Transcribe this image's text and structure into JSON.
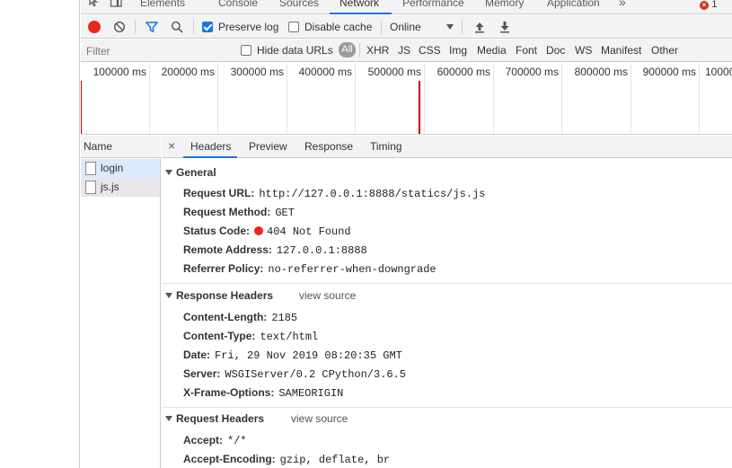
{
  "top_tabs": [
    "Elements",
    "Console",
    "Sources",
    "Network",
    "Performance",
    "Memory",
    "Application"
  ],
  "top_tabs_overflow": "»",
  "error_count": "1",
  "toolbar": {
    "preserve_log_label": "Preserve log",
    "preserve_log_checked": true,
    "disable_cache_label": "Disable cache",
    "disable_cache_checked": false,
    "throttle_value": "Online"
  },
  "filterbar": {
    "filter_placeholder": "Filter",
    "hide_data_urls_label": "Hide data URLs",
    "types": [
      "All",
      "XHR",
      "JS",
      "CSS",
      "Img",
      "Media",
      "Font",
      "Doc",
      "WS",
      "Manifest",
      "Other"
    ]
  },
  "overview": {
    "ticks": [
      "100000 ms",
      "200000 ms",
      "300000 ms",
      "400000 ms",
      "500000 ms",
      "600000 ms",
      "700000 ms",
      "800000 ms",
      "900000 ms",
      "10000"
    ]
  },
  "requests": {
    "column_name": "Name",
    "items": [
      "login",
      "js.js"
    ]
  },
  "detail_tabs": [
    "Headers",
    "Preview",
    "Response",
    "Timing"
  ],
  "general": {
    "title": "General",
    "request_url_key": "Request URL:",
    "request_url": "http://127.0.0.1:8888/statics/js.js",
    "request_method_key": "Request Method:",
    "request_method": "GET",
    "status_code_key": "Status Code:",
    "status_code": "404 Not Found",
    "status_color": "#e8281f",
    "remote_address_key": "Remote Address:",
    "remote_address": "127.0.0.1:8888",
    "referrer_policy_key": "Referrer Policy:",
    "referrer_policy": "no-referrer-when-downgrade"
  },
  "response_headers": {
    "title": "Response Headers",
    "view_source": "view source",
    "items": [
      {
        "k": "Content-Length:",
        "v": "2185"
      },
      {
        "k": "Content-Type:",
        "v": "text/html"
      },
      {
        "k": "Date:",
        "v": "Fri, 29 Nov 2019 08:20:35 GMT"
      },
      {
        "k": "Server:",
        "v": "WSGIServer/0.2 CPython/3.6.5"
      },
      {
        "k": "X-Frame-Options:",
        "v": "SAMEORIGIN"
      }
    ]
  },
  "request_headers": {
    "title": "Request Headers",
    "view_source": "view source",
    "items": [
      {
        "k": "Accept:",
        "v": "*/*"
      },
      {
        "k": "Accept-Encoding:",
        "v": "gzip, deflate, br"
      }
    ]
  }
}
